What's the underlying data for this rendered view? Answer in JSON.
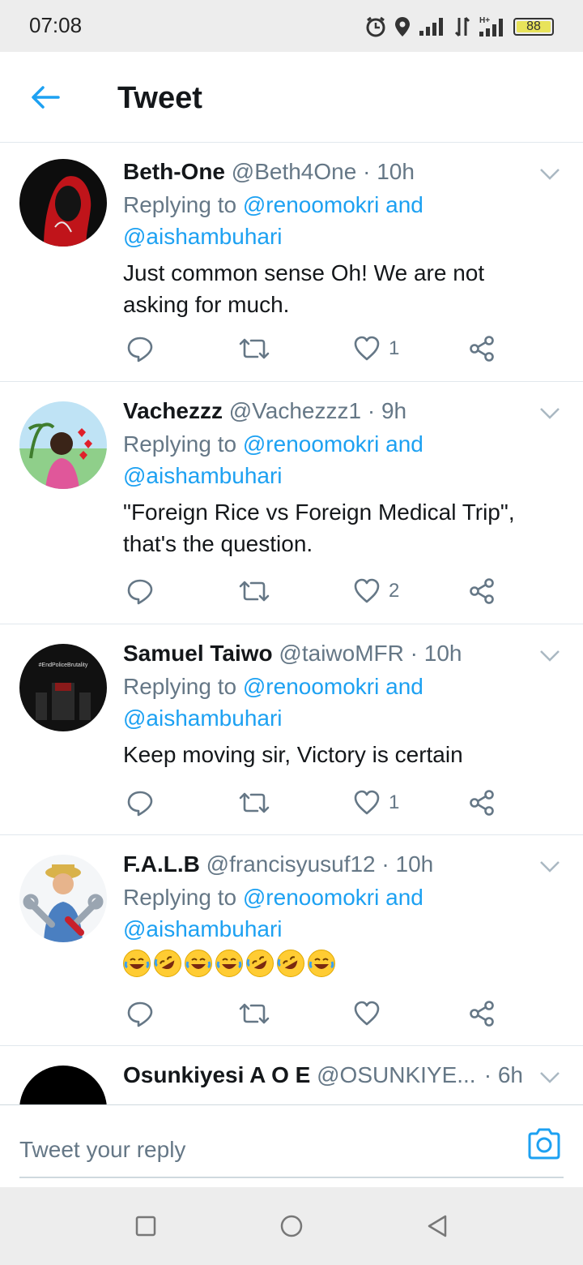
{
  "status_bar": {
    "time": "07:08",
    "battery": "88"
  },
  "header": {
    "title": "Tweet"
  },
  "tweets": [
    {
      "name": "Beth-One",
      "handle": "@Beth4One",
      "sep": "·",
      "time": "10h",
      "replying_prefix": "Replying to",
      "mention1": "@renoomokri",
      "and": "and",
      "mention2": "@aishambuhari",
      "text": "Just common sense Oh! We are not asking for much.",
      "likes": "1"
    },
    {
      "name": "Vachezzz",
      "handle": "@Vachezzz1",
      "sep": "·",
      "time": "9h",
      "replying_prefix": "Replying to",
      "mention1": "@renoomokri",
      "and": "and",
      "mention2": "@aishambuhari",
      "text": "\"Foreign Rice vs Foreign Medical Trip\", that's the question.",
      "likes": "2"
    },
    {
      "name": "Samuel Taiwo",
      "handle": "@taiwoMFR",
      "sep": "·",
      "time": "10h",
      "replying_prefix": "Replying to",
      "mention1": "@renoomokri",
      "and": "and",
      "mention2": "@aishambuhari",
      "text": "Keep moving sir, Victory is certain",
      "likes": "1",
      "avatar_text": "#EndPoliceBrutality"
    },
    {
      "name": "F.A.L.B",
      "handle": "@francisyusuf12",
      "sep": "·",
      "time": "10h",
      "replying_prefix": "Replying to",
      "mention1": "@renoomokri",
      "and": "and",
      "mention2": "@aishambuhari",
      "text": "",
      "likes": ""
    },
    {
      "name": "Osunkiyesi A O E",
      "handle": "@OSUNKIYE...",
      "sep": "·",
      "time": "6h"
    }
  ],
  "reply_bar": {
    "placeholder": "Tweet your reply"
  },
  "colors": {
    "accent": "#1da1f2",
    "muted": "#657786",
    "text": "#14171a"
  },
  "icons": [
    "back-arrow-icon",
    "reply-icon",
    "retweet-icon",
    "like-icon",
    "share-icon",
    "chevron-down-icon",
    "camera-icon",
    "nav-recents-icon",
    "nav-home-icon",
    "nav-back-icon"
  ]
}
